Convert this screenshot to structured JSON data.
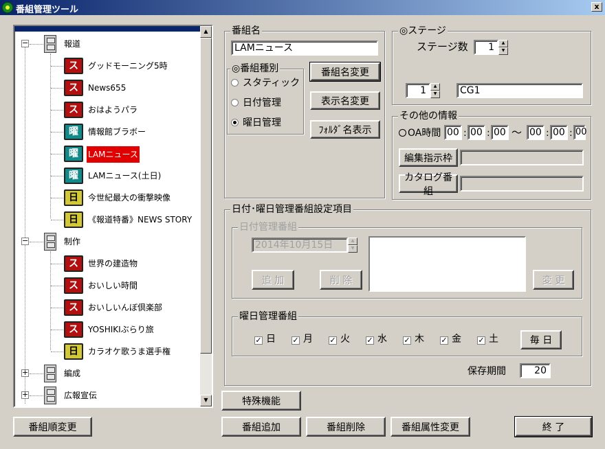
{
  "window": {
    "title": "番組管理ツール",
    "close_label": "x"
  },
  "tree": {
    "groups": [
      {
        "name": "報道",
        "expanded_sign": "−",
        "items": [
          {
            "icon": "ス",
            "type": "static",
            "label": "グッドモーニング5時"
          },
          {
            "icon": "ス",
            "type": "static",
            "label": "News655"
          },
          {
            "icon": "ス",
            "type": "static",
            "label": "おはようパラ"
          },
          {
            "icon": "曜",
            "type": "weekday",
            "label": "情報館ブラボー"
          },
          {
            "icon": "曜",
            "type": "weekday",
            "label": "LAMニュース",
            "selected": true
          },
          {
            "icon": "曜",
            "type": "weekday",
            "label": "LAMニュース(土日)"
          },
          {
            "icon": "日",
            "type": "date",
            "label": "今世紀最大の衝撃映像"
          },
          {
            "icon": "日",
            "type": "date",
            "label": "《報道特番》NEWS STORY"
          }
        ]
      },
      {
        "name": "制作",
        "expanded_sign": "−",
        "items": [
          {
            "icon": "ス",
            "type": "static",
            "label": "世界の建造物"
          },
          {
            "icon": "ス",
            "type": "static",
            "label": "おいしい時間"
          },
          {
            "icon": "ス",
            "type": "static",
            "label": "おいしいんぼ倶楽部"
          },
          {
            "icon": "ス",
            "type": "static",
            "label": "YOSHIKIぶらり旅"
          },
          {
            "icon": "日",
            "type": "date",
            "label": "カラオケ歌うま選手権"
          }
        ]
      },
      {
        "name": "編成",
        "expanded_sign": "+",
        "items": []
      },
      {
        "name": "広報宣伝",
        "expanded_sign": "+",
        "items": []
      }
    ]
  },
  "program_name": {
    "legend": "番組名",
    "value": "LAMニュース",
    "type_legend": "◎番組種別",
    "types": [
      "スタティック",
      "日付管理",
      "曜日管理"
    ],
    "selected_type": 2,
    "rename_button": "番組名変更",
    "display_name_button": "表示名変更",
    "folder_button": "ﾌｫﾙﾀﾞ名表示"
  },
  "stage": {
    "legend": "◎ステージ",
    "count_label": "ステージ数",
    "count_value": "1",
    "index_value": "1",
    "name_value": "CG1"
  },
  "other_info": {
    "legend": "その他の情報",
    "oa_label": "OA時間",
    "start": [
      "00",
      "00",
      "00"
    ],
    "end": [
      "00",
      "00",
      "00"
    ],
    "time_sep": ":",
    "range_sep": "〜",
    "edit_frame_button": "編集指示枠",
    "edit_frame_value": "",
    "catalog_button": "カタログ番組",
    "catalog_value": ""
  },
  "settings": {
    "legend": "日付･曜日管理番組設定項目",
    "date_legend": "日付管理番組",
    "date_value": "2014年10月15日",
    "add_button": "追 加",
    "delete_button": "削 除",
    "change_button": "変 更",
    "weekday_legend": "曜日管理番組",
    "days": [
      "日",
      "月",
      "火",
      "水",
      "木",
      "金",
      "土"
    ],
    "days_checked": [
      true,
      true,
      true,
      true,
      true,
      true,
      true
    ],
    "check_mark": "✓",
    "everyday_button": "毎 日",
    "retention_label": "保存期間",
    "retention_value": "20"
  },
  "buttons": {
    "special": "特殊機能",
    "reorder": "番組順変更",
    "add_program": "番組追加",
    "delete_program": "番組削除",
    "change_attr": "番組属性変更",
    "exit": "終 了"
  }
}
